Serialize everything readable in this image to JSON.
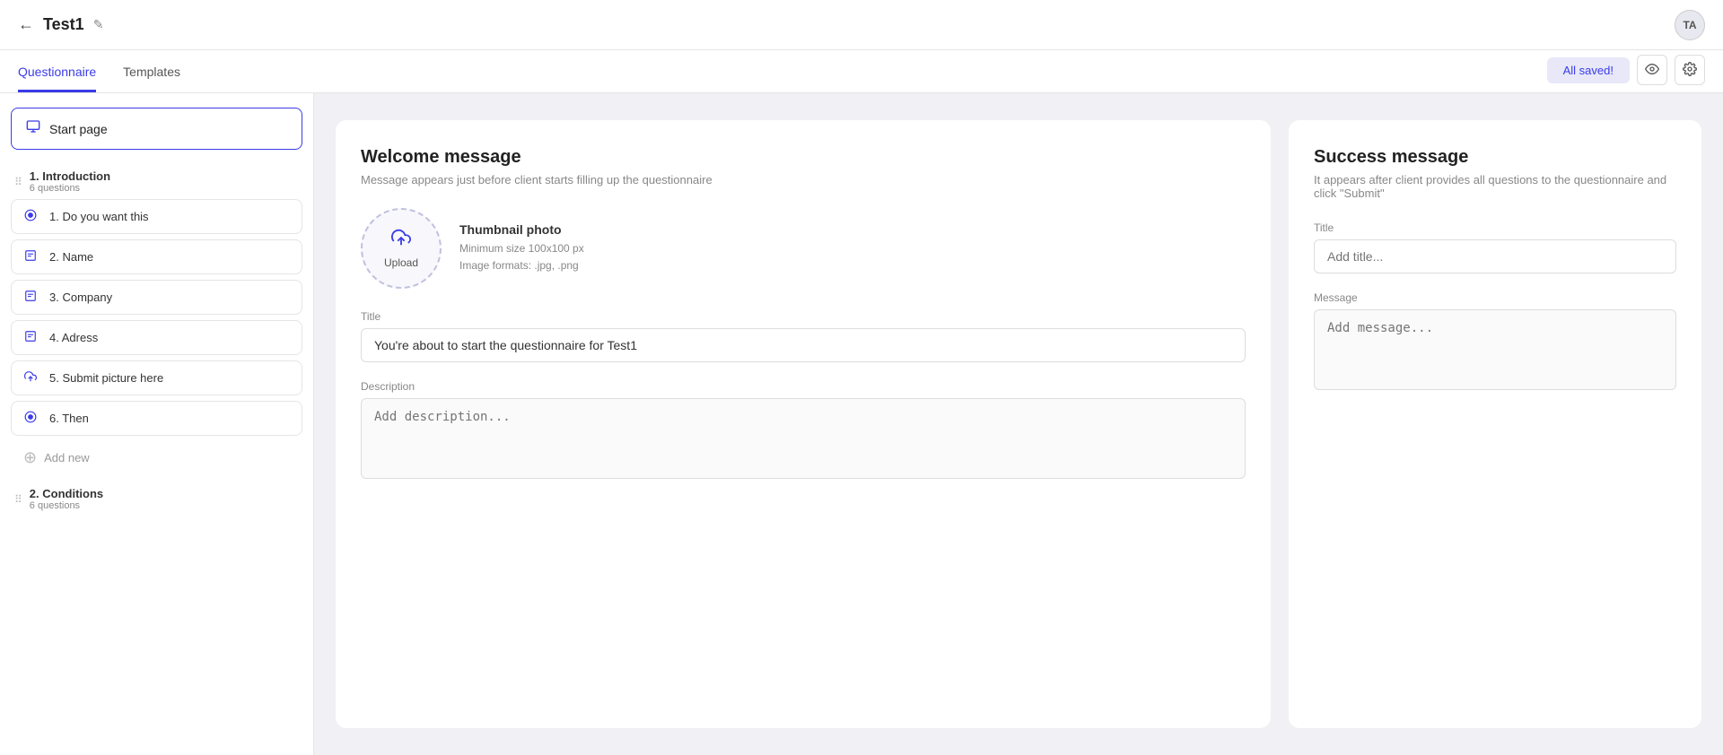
{
  "topbar": {
    "title": "Test1",
    "avatar": "TA",
    "back_icon": "←",
    "edit_icon": "✎"
  },
  "nav": {
    "tabs": [
      {
        "id": "questionnaire",
        "label": "Questionnaire",
        "active": true
      },
      {
        "id": "templates",
        "label": "Templates",
        "active": false
      }
    ],
    "all_saved_label": "All saved!",
    "preview_icon": "👁",
    "settings_icon": "⚙"
  },
  "sidebar": {
    "start_page_label": "Start page",
    "sections": [
      {
        "id": "introduction",
        "title": "1. Introduction",
        "count": "6 questions",
        "questions": [
          {
            "id": "q1",
            "icon": "radio",
            "label": "1. Do you want this"
          },
          {
            "id": "q2",
            "icon": "text",
            "label": "2. Name"
          },
          {
            "id": "q3",
            "icon": "text",
            "label": "3. Company"
          },
          {
            "id": "q4",
            "icon": "text",
            "label": "4. Adress"
          },
          {
            "id": "q5",
            "icon": "upload",
            "label": "5. Submit picture here"
          },
          {
            "id": "q6",
            "icon": "radio",
            "label": "6. Then"
          }
        ],
        "add_new_label": "Add new"
      },
      {
        "id": "conditions",
        "title": "2. Conditions",
        "count": "6 questions",
        "questions": []
      }
    ]
  },
  "welcome_panel": {
    "title": "Welcome message",
    "subtitle": "Message appears just before client starts filling up the questionnaire",
    "upload": {
      "label": "Upload",
      "photo_title": "Thumbnail photo",
      "min_size": "Minimum size 100x100 px",
      "formats": "Image formats: .jpg, .png"
    },
    "title_field": {
      "label": "Title",
      "value": "You're about to start the questionnaire for Test1"
    },
    "description_field": {
      "label": "Description",
      "placeholder": "Add description..."
    }
  },
  "success_panel": {
    "title": "Success message",
    "subtitle": "It appears after client provides all questions to the questionnaire and click \"Submit\"",
    "title_field": {
      "label": "Title",
      "placeholder": "Add title..."
    },
    "message_field": {
      "label": "Message",
      "placeholder": "Add message..."
    }
  }
}
